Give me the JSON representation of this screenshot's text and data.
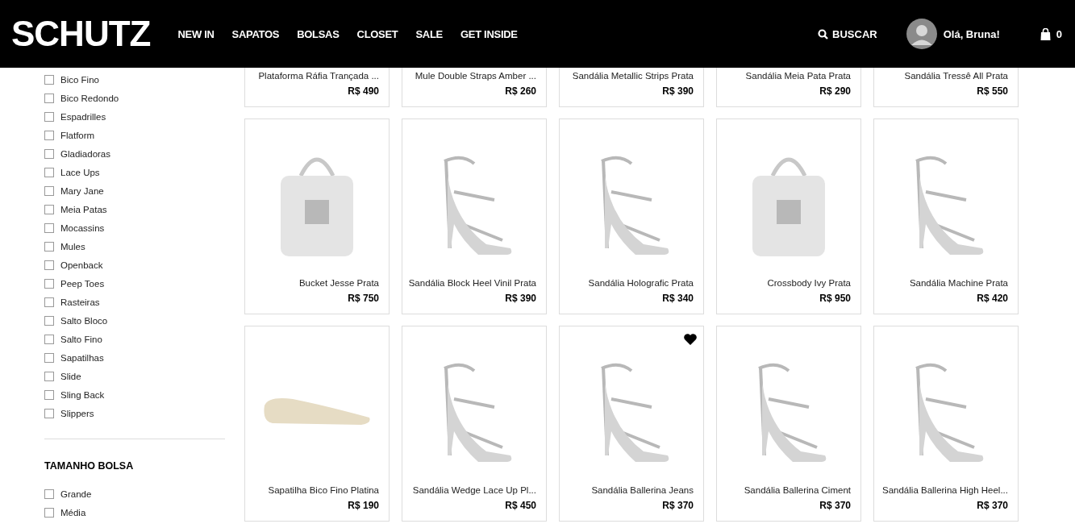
{
  "header": {
    "logo": "SCHUTZ",
    "nav": [
      "NEW IN",
      "SAPATOS",
      "BOLSAS",
      "CLOSET",
      "SALE",
      "GET INSIDE"
    ],
    "search": "BUSCAR",
    "greeting": "Olá, Bruna!",
    "cart_count": "0"
  },
  "filters": [
    {
      "options": [
        {
          "label": "Bico Fino",
          "checked": false
        },
        {
          "label": "Bico Redondo",
          "checked": false
        },
        {
          "label": "Espadrilles",
          "checked": false
        },
        {
          "label": "Flatform",
          "checked": false
        },
        {
          "label": "Gladiadoras",
          "checked": false
        },
        {
          "label": "Lace Ups",
          "checked": false
        },
        {
          "label": "Mary Jane",
          "checked": false
        },
        {
          "label": "Meia Patas",
          "checked": false
        },
        {
          "label": "Mocassins",
          "checked": false
        },
        {
          "label": "Mules",
          "checked": false
        },
        {
          "label": "Openback",
          "checked": false
        },
        {
          "label": "Peep Toes",
          "checked": false
        },
        {
          "label": "Rasteiras",
          "checked": false
        },
        {
          "label": "Salto Bloco",
          "checked": false
        },
        {
          "label": "Salto Fino",
          "checked": false
        },
        {
          "label": "Sapatilhas",
          "checked": false
        },
        {
          "label": "Slide",
          "checked": false
        },
        {
          "label": "Sling Back",
          "checked": false
        },
        {
          "label": "Slippers",
          "checked": false
        }
      ]
    },
    {
      "title": "TAMANHO BOLSA",
      "options": [
        {
          "label": "Grande",
          "checked": false
        },
        {
          "label": "Média",
          "checked": false
        }
      ]
    }
  ],
  "scrolled_row": [
    {
      "name": "Plataforma Ráfia Trançada ...",
      "price": "R$ 490"
    },
    {
      "name": "Mule Double Straps Amber ...",
      "price": "R$ 260"
    },
    {
      "name": "Sandália Metallic Strips Prata",
      "price": "R$ 390"
    },
    {
      "name": "Sandália Meia Pata Prata",
      "price": "R$ 290"
    },
    {
      "name": "Sandália Tressê All Prata",
      "price": "R$ 550"
    }
  ],
  "products": [
    {
      "kind": "bag",
      "name": "Bucket Jesse Prata",
      "price": "R$ 750",
      "favorite": false
    },
    {
      "kind": "heel",
      "name": "Sandália Block Heel Vinil Prata",
      "price": "R$ 390",
      "favorite": false
    },
    {
      "kind": "heel",
      "name": "Sandália Holografic Prata",
      "price": "R$ 340",
      "favorite": false
    },
    {
      "kind": "bag",
      "name": "Crossbody Ivy Prata",
      "price": "R$ 950",
      "favorite": false
    },
    {
      "kind": "heel",
      "name": "Sandália Machine Prata",
      "price": "R$ 420",
      "favorite": false
    },
    {
      "kind": "flat",
      "name": "Sapatilha Bico Fino Platina",
      "price": "R$ 190",
      "favorite": false
    },
    {
      "kind": "heel",
      "name": "Sandália Wedge Lace Up Pl...",
      "price": "R$ 450",
      "favorite": false
    },
    {
      "kind": "heel",
      "name": "Sandália Ballerina Jeans",
      "price": "R$ 370",
      "favorite": true
    },
    {
      "kind": "heel",
      "name": "Sandália Ballerina Ciment",
      "price": "R$ 370",
      "favorite": false
    },
    {
      "kind": "heel",
      "name": "Sandália Ballerina High Heel...",
      "price": "R$ 370",
      "favorite": false
    }
  ]
}
